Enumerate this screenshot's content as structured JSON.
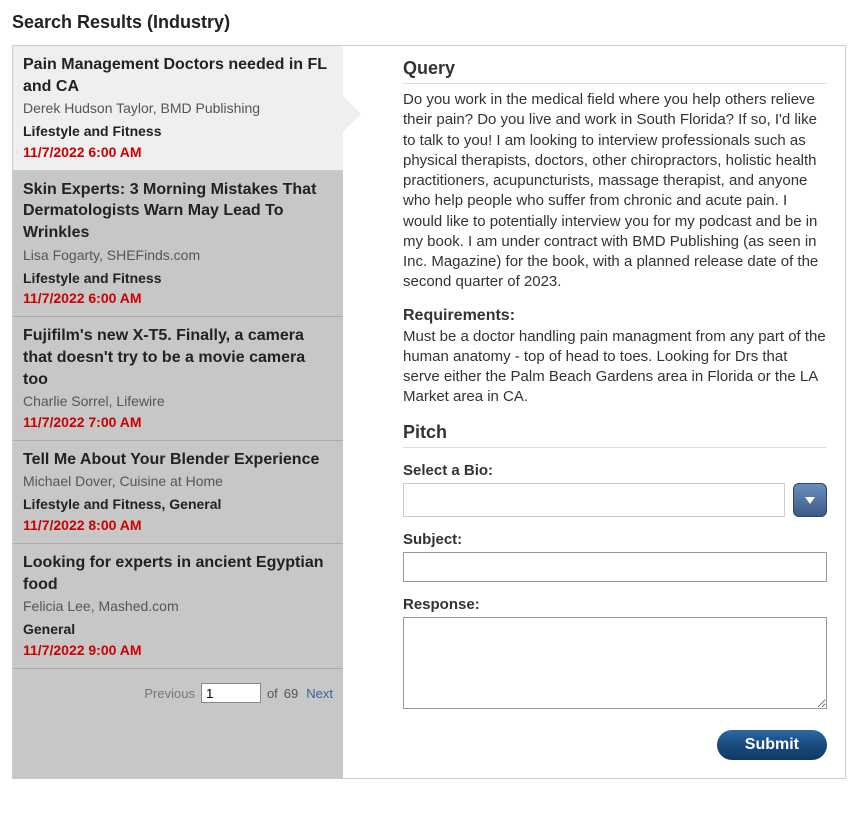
{
  "page_title": "Search Results (Industry)",
  "results": [
    {
      "title": "Pain Management Doctors needed in FL and CA",
      "author": "Derek Hudson Taylor, BMD Publishing",
      "tags": "Lifestyle and Fitness",
      "date": "11/7/2022 6:00 AM",
      "selected": true
    },
    {
      "title": "Skin Experts: 3 Morning Mistakes That Dermatologists Warn May Lead To Wrinkles",
      "author": "Lisa Fogarty, SHEFinds.com",
      "tags": "Lifestyle and Fitness",
      "date": "11/7/2022 6:00 AM",
      "selected": false
    },
    {
      "title": "Fujifilm's new X-T5. Finally, a camera that doesn't try to be a movie camera too",
      "author": "Charlie Sorrel, Lifewire",
      "tags": "",
      "date": "11/7/2022 7:00 AM",
      "selected": false
    },
    {
      "title": "Tell Me About Your Blender Experience",
      "author": "Michael Dover, Cuisine at Home",
      "tags": "Lifestyle and Fitness, General",
      "date": "11/7/2022 8:00 AM",
      "selected": false
    },
    {
      "title": "Looking for experts in ancient Egyptian food",
      "author": "Felicia Lee, Mashed.com",
      "tags": "General",
      "date": "11/7/2022 9:00 AM",
      "selected": false
    }
  ],
  "pager": {
    "previous_label": "Previous",
    "current_page": "1",
    "of_label": "of",
    "total_pages": "69",
    "next_label": "Next"
  },
  "detail": {
    "query_heading": "Query",
    "query_body": "Do you work in the medical field where you help others relieve their pain? Do you live and work in South Florida? If so, I'd like to talk to you! I am looking to interview professionals such as physical therapists, doctors, other chiropractors, holistic health practitioners, acupuncturists, massage therapist, and anyone who help people who suffer from chronic and acute pain. I would like to potentially interview you for my podcast and be in my book. I am under contract with BMD Publishing (as seen in Inc. Magazine) for the book, with a planned release date of the second quarter of 2023.",
    "requirements_heading": "Requirements:",
    "requirements_body": "Must be a doctor handling pain managment from any part of the human anatomy - top of head to toes. Looking for Drs that serve either the Palm Beach Gardens area in Florida or the LA Market area in CA.",
    "pitch_heading": "Pitch",
    "bio_label": "Select a Bio:",
    "bio_value": "",
    "subject_label": "Subject:",
    "subject_value": "",
    "response_label": "Response:",
    "response_value": "",
    "submit_label": "Submit"
  }
}
